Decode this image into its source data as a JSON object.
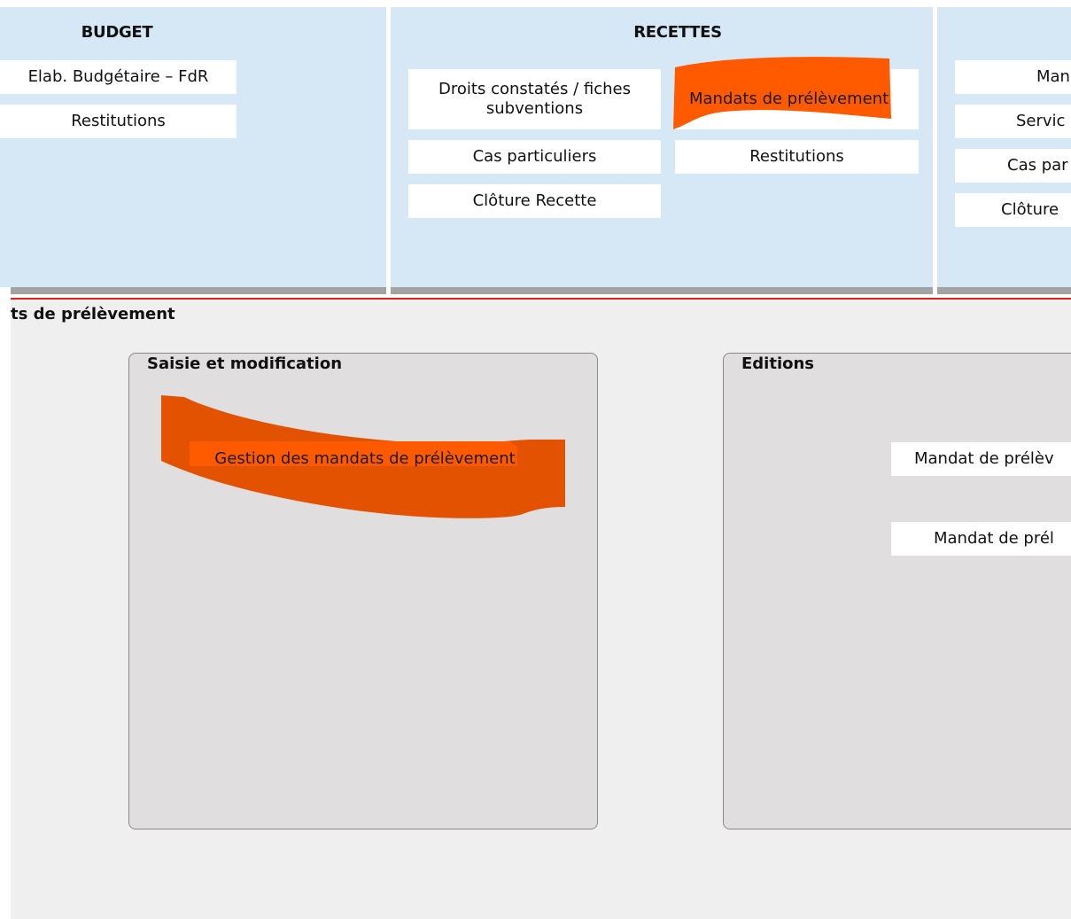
{
  "colors": {
    "menu_bg": "#d6e8f6",
    "highlight": "#ff5a00",
    "highlight_dark": "#e35200",
    "panel_bg": "#e0dedf",
    "content_bg": "#efefef",
    "separator_red": "#e2231a"
  },
  "menu": {
    "budget": {
      "title": "BUDGET",
      "items": [
        "Elab. Budgétaire – FdR",
        "Restitutions"
      ]
    },
    "recettes": {
      "title": "RECETTES",
      "items": [
        "Droits constatés / fiches subventions",
        "Mandats de prélèvement",
        "Cas particuliers",
        "Restitutions",
        "Clôture Recette"
      ]
    },
    "third": {
      "items": [
        "Man",
        "Servic",
        "Cas par",
        "Clôture"
      ]
    }
  },
  "page": {
    "section_title": "ts de prélèvement"
  },
  "groups": {
    "saisie": {
      "title": "Saisie et modification",
      "items": [
        "Gestion des mandats de prélèvement"
      ]
    },
    "editions": {
      "title": "Editions",
      "items": [
        "Mandat de prélèv",
        "Mandat de prél"
      ]
    }
  }
}
